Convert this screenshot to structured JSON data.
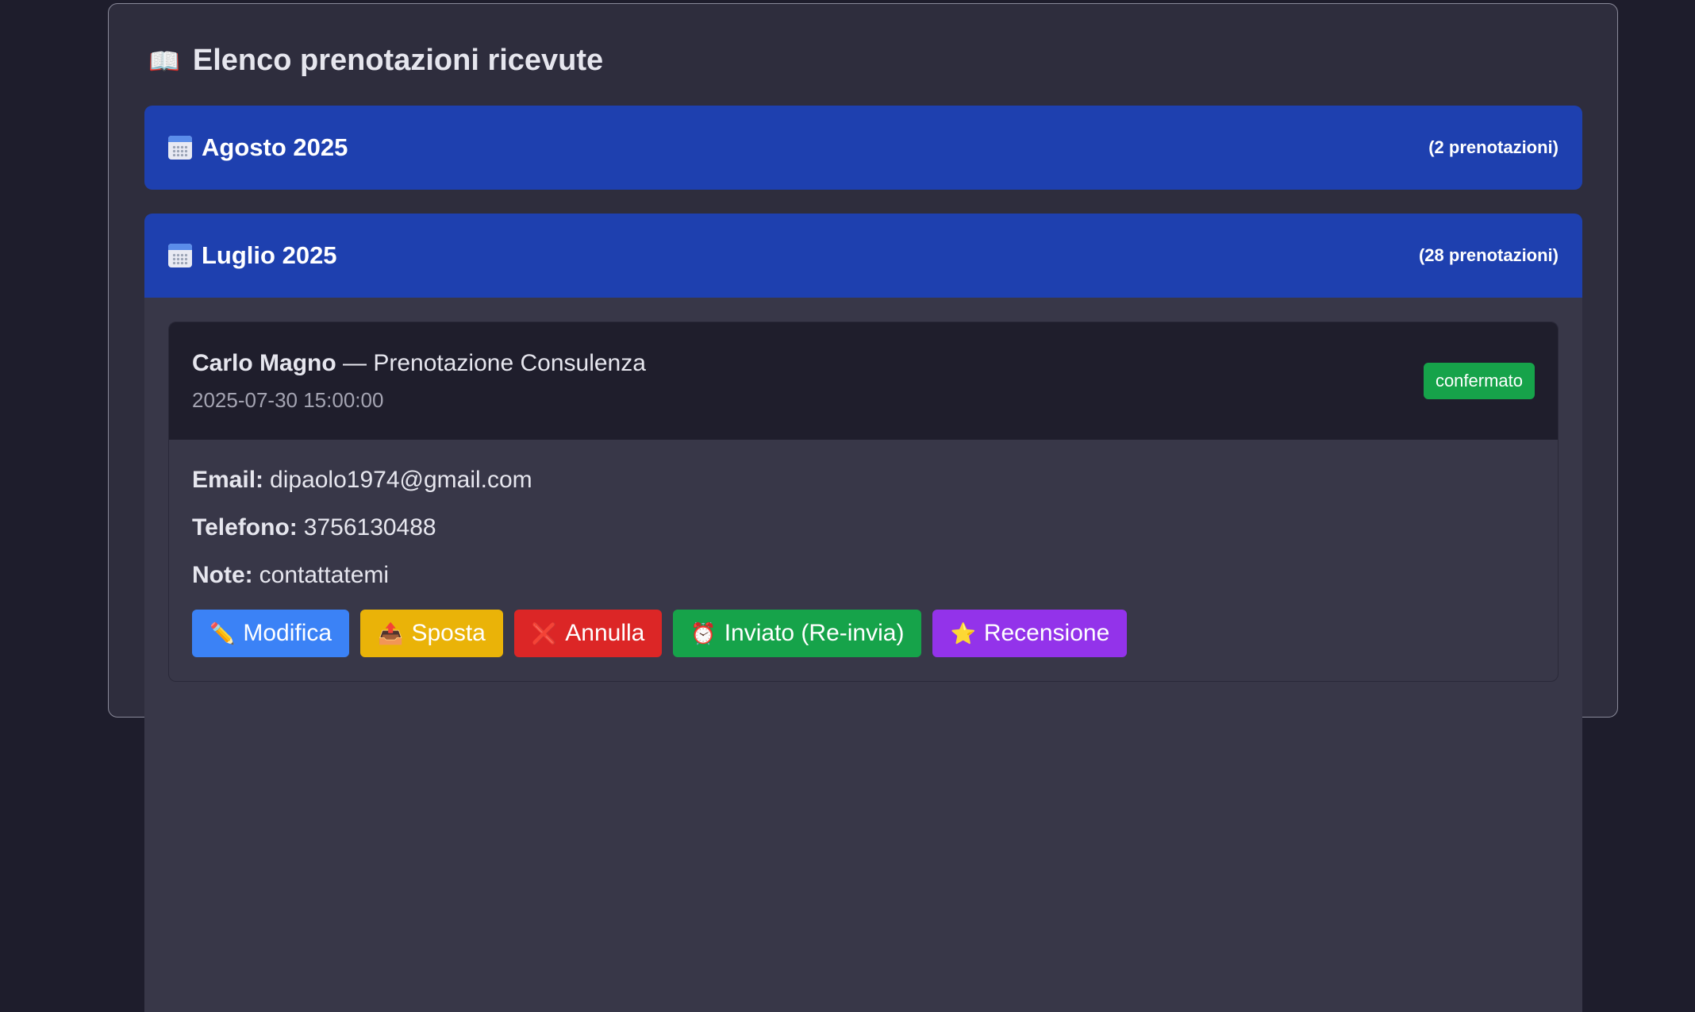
{
  "title": "Elenco prenotazioni ricevute",
  "months": [
    {
      "name": "Agosto 2025",
      "count": "(2 prenotazioni)"
    },
    {
      "name": "Luglio 2025",
      "count": "(28 prenotazioni)"
    }
  ],
  "booking": {
    "name": "Carlo Magno",
    "service": " — Prenotazione Consulenza",
    "datetime": "2025-07-30 15:00:00",
    "status": "confermato",
    "email_label": "Email:",
    "email": "dipaolo1974@gmail.com",
    "phone_label": "Telefono:",
    "phone": "3756130488",
    "note_label": "Note:",
    "note": "contattatemi"
  },
  "actions": {
    "edit": "Modifica",
    "move": "Sposta",
    "cancel": "Annulla",
    "resend": "Inviato (Re-invia)",
    "review": "Recensione"
  },
  "icons": {
    "title": "book-icon",
    "month": "calendar-icon",
    "edit": "pencil-icon",
    "move": "outbox-icon",
    "cancel": "cross-icon",
    "resend": "alarm-clock-icon",
    "review": "star-icon"
  },
  "colors": {
    "month_header": "#1e40af",
    "status_confirmed": "#16a34a",
    "edit": "#3b82f6",
    "move": "#eab308",
    "cancel": "#dc2626",
    "resend": "#16a34a",
    "review": "#9333ea"
  }
}
